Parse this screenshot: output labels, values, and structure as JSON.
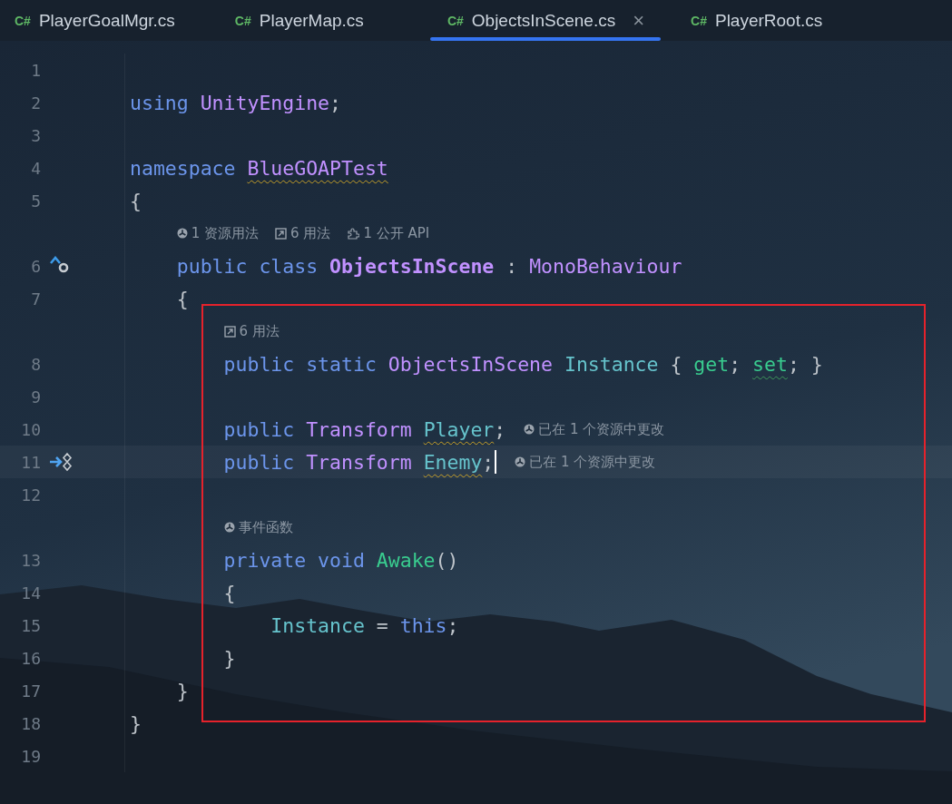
{
  "tabs": [
    {
      "icon": "C#",
      "label": "PlayerGoalMgr.cs",
      "selected": false
    },
    {
      "icon": "C#",
      "label": "PlayerMap.cs",
      "selected": false
    },
    {
      "icon": "C#",
      "label": "ObjectsInScene.cs",
      "selected": true,
      "close": "×"
    },
    {
      "icon": "C#",
      "label": "PlayerRoot.cs",
      "selected": false
    }
  ],
  "editor": {
    "lines": [
      {
        "kind": "code",
        "number": "1"
      },
      {
        "kind": "code",
        "number": "2",
        "tokens": [
          {
            "text": "using ",
            "kind": "keyword"
          },
          {
            "text": "UnityEngine",
            "kind": "type"
          },
          {
            "text": ";",
            "kind": "punct"
          }
        ]
      },
      {
        "kind": "code",
        "number": "3"
      },
      {
        "kind": "code",
        "number": "4",
        "tokens": [
          {
            "text": "namespace ",
            "kind": "keyword"
          },
          {
            "text": "BlueGOAPTest",
            "kind": "type",
            "warning": true
          }
        ]
      },
      {
        "kind": "code",
        "number": "5",
        "tokens": [
          {
            "text": "{",
            "kind": "punct"
          }
        ]
      },
      {
        "kind": "hints",
        "hints": [
          {
            "kind": "unity",
            "text": "1 资源用法"
          },
          {
            "kind": "usages",
            "text": "6 用法"
          },
          {
            "kind": "api",
            "text": "1 公开 API"
          }
        ]
      },
      {
        "kind": "code",
        "number": "6",
        "has_inheritors": true,
        "tokens": [
          {
            "text": "    public class ",
            "kind": "keyword"
          },
          {
            "text": "ObjectsInScene",
            "kind": "declaration"
          },
          {
            "text": " : ",
            "kind": "punct"
          },
          {
            "text": "MonoBehaviour",
            "kind": "type"
          }
        ]
      },
      {
        "kind": "code",
        "number": "7",
        "tokens": [
          {
            "text": "    {",
            "kind": "punct"
          }
        ]
      },
      {
        "kind": "hints",
        "hints": [
          {
            "kind": "usages",
            "text": "6 用法"
          }
        ]
      },
      {
        "kind": "code",
        "number": "8",
        "tokens": [
          {
            "text": "        public static ",
            "kind": "keyword"
          },
          {
            "text": "ObjectsInScene ",
            "kind": "type"
          },
          {
            "text": "Instance",
            "kind": "field"
          },
          {
            "text": " { ",
            "kind": "punct"
          },
          {
            "text": "get",
            "kind": "method"
          },
          {
            "text": "; ",
            "kind": "punct"
          },
          {
            "text": "set",
            "kind": "method",
            "suggestion": true
          },
          {
            "text": "; }",
            "kind": "punct"
          }
        ]
      },
      {
        "kind": "code",
        "number": "9"
      },
      {
        "kind": "code",
        "number": "10",
        "tokens": [
          {
            "text": "        public ",
            "kind": "keyword"
          },
          {
            "text": "Transform ",
            "kind": "type"
          },
          {
            "text": "Player",
            "kind": "field",
            "warning": true
          },
          {
            "text": ";",
            "kind": "punct"
          }
        ],
        "inlay": {
          "kind": "unity",
          "text": "已在 1 个资源中更改"
        }
      },
      {
        "kind": "code",
        "number": "11",
        "unity_serialized": true,
        "current": true,
        "caret": true,
        "tokens": [
          {
            "text": "        public ",
            "kind": "keyword"
          },
          {
            "text": "Transform ",
            "kind": "type"
          },
          {
            "text": "Enemy",
            "kind": "field",
            "warning": true
          },
          {
            "text": ";",
            "kind": "punct"
          }
        ],
        "inlay": {
          "kind": "unity",
          "text": "已在 1 个资源中更改"
        }
      },
      {
        "kind": "code",
        "number": "12"
      },
      {
        "kind": "hints",
        "hints": [
          {
            "kind": "unity",
            "text": "事件函数"
          }
        ]
      },
      {
        "kind": "code",
        "number": "13",
        "tokens": [
          {
            "text": "        private void ",
            "kind": "keyword"
          },
          {
            "text": "Awake",
            "kind": "method"
          },
          {
            "text": "()",
            "kind": "punct"
          }
        ]
      },
      {
        "kind": "code",
        "number": "14",
        "tokens": [
          {
            "text": "        {",
            "kind": "punct"
          }
        ]
      },
      {
        "kind": "code",
        "number": "15",
        "tokens": [
          {
            "text": "            Instance",
            "kind": "field"
          },
          {
            "text": " = ",
            "kind": "punct"
          },
          {
            "text": "this",
            "kind": "keyword"
          },
          {
            "text": ";",
            "kind": "punct"
          }
        ]
      },
      {
        "kind": "code",
        "number": "16",
        "tokens": [
          {
            "text": "        }",
            "kind": "punct"
          }
        ]
      },
      {
        "kind": "code",
        "number": "17",
        "tokens": [
          {
            "text": "    }",
            "kind": "punct"
          }
        ]
      },
      {
        "kind": "code",
        "number": "18",
        "tokens": [
          {
            "text": "}",
            "kind": "punct"
          }
        ]
      },
      {
        "kind": "code",
        "number": "19"
      }
    ]
  }
}
